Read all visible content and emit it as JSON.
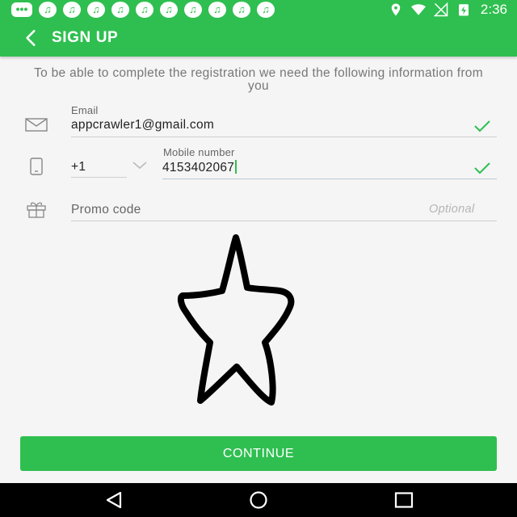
{
  "status_bar": {
    "time": "2:36",
    "notification_icons": [
      "message-icon",
      "music-note-icon",
      "music-note-icon",
      "music-note-icon",
      "music-note-icon",
      "music-note-icon",
      "music-note-icon",
      "music-note-icon",
      "music-note-icon",
      "music-note-icon",
      "music-note-icon"
    ],
    "system_icons": [
      "location-icon",
      "wifi-icon",
      "no-signal-icon",
      "battery-charging-icon"
    ]
  },
  "app_bar": {
    "title": "SIGN UP",
    "back_icon": "chevron-left-icon"
  },
  "intro_text": "To be able to complete the registration we need the following information from you",
  "form": {
    "email": {
      "label": "Email",
      "value": "appcrawler1@gmail.com",
      "icon": "mail-icon",
      "valid_icon": "check-icon"
    },
    "phone": {
      "country_code": "+1",
      "dropdown_icon": "chevron-down-icon",
      "label": "Mobile number",
      "value": "4153402067",
      "icon": "phone-icon",
      "valid_icon": "check-icon"
    },
    "promo": {
      "placeholder": "Promo code",
      "hint": "Optional",
      "icon": "gift-icon"
    }
  },
  "overlay": {
    "icon": "star-outline-icon"
  },
  "continue_label": "CONTINUE",
  "nav": {
    "back_icon": "nav-back-icon",
    "home_icon": "nav-home-icon",
    "recents_icon": "nav-recents-icon"
  },
  "colors": {
    "brand_green": "#2fbf50",
    "check_green": "#2fbf50",
    "background": "#f5f5f5"
  }
}
